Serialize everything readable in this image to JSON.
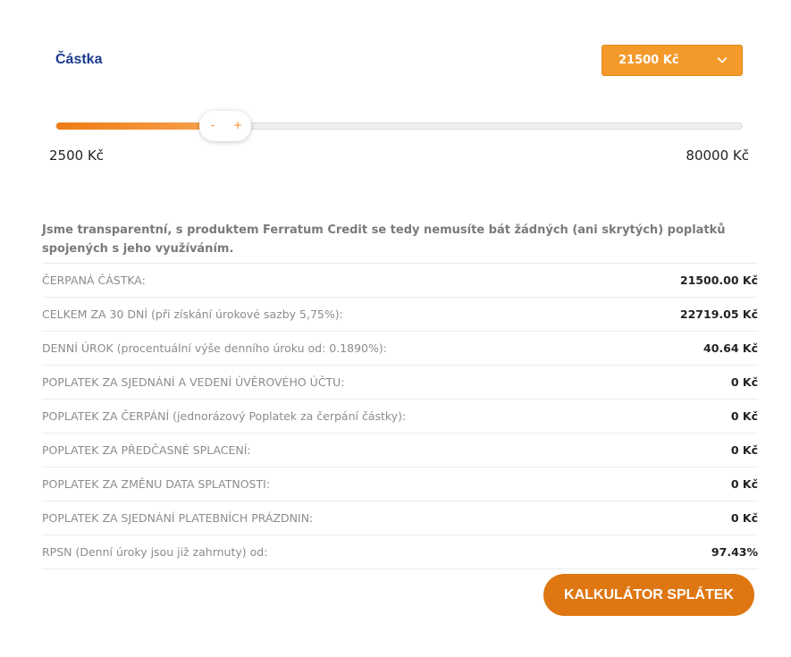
{
  "amount": {
    "label": "Částka",
    "selected_value": "21500 Kč",
    "slider_min_label": "2500 Kč",
    "slider_max_label": "80000 Kč",
    "slider_value": 21500,
    "slider_min": 2500,
    "slider_max": 80000,
    "minus_label": "-",
    "plus_label": "+"
  },
  "intro_text": "Jsme transparentní, s produktem Ferratum Credit se tedy nemusíte bát žádných (ani skrytých) poplatků spojených s jeho využíváním.",
  "rows": [
    {
      "label": "ČERPANÁ ČÁSTKA:",
      "value": "21500.00 Kč"
    },
    {
      "label": "CELKEM ZA 30 DNÍ (při získání úrokové sazby 5,75%):",
      "value": "22719.05 Kč"
    },
    {
      "label": "DENNÍ ÚROK (procentuální výše denního úroku od: 0.1890%):",
      "value": "40.64 Kč"
    },
    {
      "label": "POPLATEK ZA SJEDNÁNÍ A VEDENÍ ÚVĚROVÉHO ÚČTU:",
      "value": "0 Kč"
    },
    {
      "label": "POPLATEK ZA ČERPÁNÍ (jednorázový Poplatek za čerpání částky):",
      "value": "0 Kč"
    },
    {
      "label": "POPLATEK ZA PŘEDČASNÉ SPLACENÍ:",
      "value": "0 Kč"
    },
    {
      "label": "POPLATEK ZA ZMĚNU DATA SPLATNOSTI:",
      "value": "0 Kč"
    },
    {
      "label": "POPLATEK ZA SJEDNÁNÍ PLATEBNÍCH PRÁZDNIN:",
      "value": "0 Kč"
    },
    {
      "label": "RPSN (Denní úroky jsou již zahrnuty) od:",
      "value": "97.43%"
    }
  ],
  "calculator_button": "KALKULÁTOR SPLÁTEK",
  "colors": {
    "accent": "#f39a2b",
    "button": "#de7712",
    "label_blue": "#1c3c8f"
  },
  "icons": {
    "dropdown": "chevron-down-icon"
  }
}
